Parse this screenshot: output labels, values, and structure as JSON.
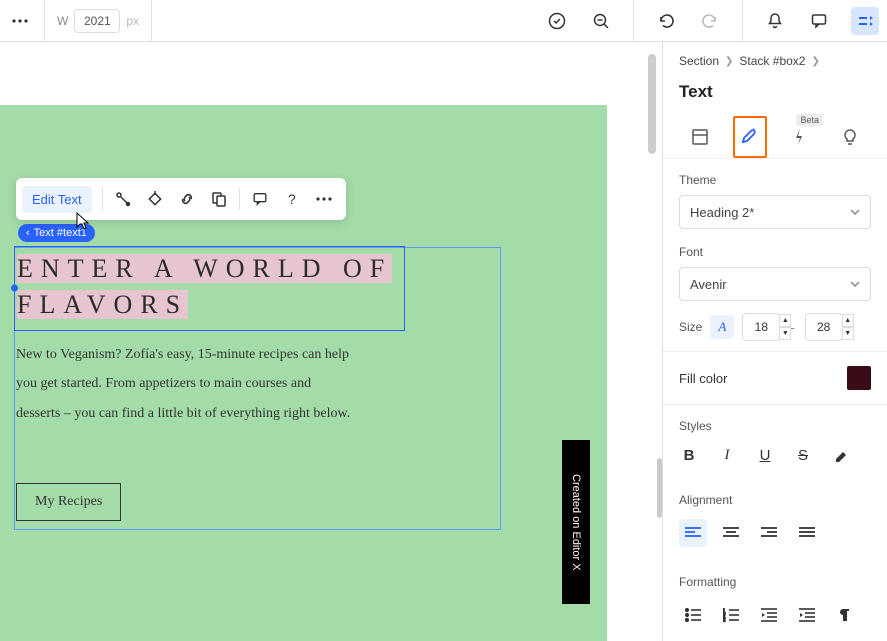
{
  "topbar": {
    "width_label": "W",
    "width_value": "2021",
    "unit": "px"
  },
  "canvas": {
    "floating_toolbar": {
      "edit_text": "Edit Text"
    },
    "element_tag": "Text #text1",
    "heading": "ENTER A WORLD OF FLAVORS",
    "body": "New to Veganism? Zofía's easy, 15-minute recipes can help you get started. From appetizers to main courses and desserts – you can find a little bit of everything right below.",
    "button": "My Recipes",
    "badge": "Created on Editor X"
  },
  "side": {
    "breadcrumb": {
      "a": "Section",
      "b": "Stack #box2"
    },
    "title": "Text",
    "beta_label": "Beta",
    "theme": {
      "label": "Theme",
      "value": "Heading 2*"
    },
    "font": {
      "label": "Font",
      "value": "Avenir"
    },
    "size": {
      "label": "Size",
      "sep": "-",
      "min": "18",
      "max": "28"
    },
    "fill": {
      "label": "Fill color",
      "color": "#3a0d16"
    },
    "styles_label": "Styles",
    "align_label": "Alignment",
    "fmt_label": "Formatting"
  }
}
